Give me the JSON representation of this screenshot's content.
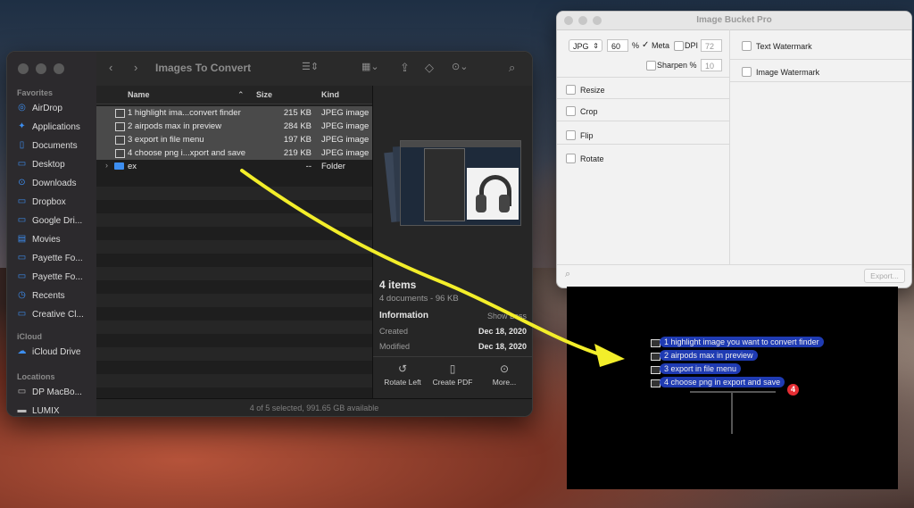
{
  "finder": {
    "title": "Images To Convert",
    "sidebar": {
      "favorites_header": "Favorites",
      "favorites": [
        {
          "label": "AirDrop",
          "icon": "airdrop-icon"
        },
        {
          "label": "Applications",
          "icon": "applications-icon"
        },
        {
          "label": "Documents",
          "icon": "document-icon"
        },
        {
          "label": "Desktop",
          "icon": "desktop-icon"
        },
        {
          "label": "Downloads",
          "icon": "downloads-icon"
        },
        {
          "label": "Dropbox",
          "icon": "folder-icon"
        },
        {
          "label": "Google Dri...",
          "icon": "folder-icon"
        },
        {
          "label": "Movies",
          "icon": "movies-icon"
        },
        {
          "label": "Payette Fo...",
          "icon": "folder-icon"
        },
        {
          "label": "Payette Fo...",
          "icon": "folder-icon"
        },
        {
          "label": "Recents",
          "icon": "clock-icon"
        },
        {
          "label": "Creative Cl...",
          "icon": "folder-icon"
        }
      ],
      "icloud_header": "iCloud",
      "icloud": [
        {
          "label": "iCloud Drive",
          "icon": "cloud-icon"
        }
      ],
      "locations_header": "Locations",
      "locations": [
        {
          "label": "DP MacBo...",
          "icon": "laptop-icon"
        },
        {
          "label": "LUMIX",
          "icon": "disk-icon"
        }
      ]
    },
    "columns": {
      "name": "Name",
      "size": "Size",
      "kind": "Kind"
    },
    "rows": [
      {
        "name": "1 highlight ima...convert finder",
        "size": "215 KB",
        "kind": "JPEG image",
        "selected": true
      },
      {
        "name": "2 airpods max in preview",
        "size": "284 KB",
        "kind": "JPEG image",
        "selected": true
      },
      {
        "name": "3 export in file menu",
        "size": "197 KB",
        "kind": "JPEG image",
        "selected": true
      },
      {
        "name": "4 choose png i...xport and save",
        "size": "219 KB",
        "kind": "JPEG image",
        "selected": true
      },
      {
        "name": "ex",
        "size": "--",
        "kind": "Folder",
        "selected": false
      }
    ],
    "preview": {
      "count": "4 items",
      "subtitle": "4 documents - 9",
      "subtitle_tail": "6 KB",
      "info_header": "Information",
      "show_less": "Show Less",
      "created_label": "Created",
      "created_value": "Dec 18, 2020",
      "modified_label": "Modified",
      "modified_value": "Dec 18, 2020",
      "actions": [
        {
          "label": "Rotate Left",
          "icon": "rotate-left-icon"
        },
        {
          "label": "Create PDF",
          "icon": "pdf-icon"
        },
        {
          "label": "More...",
          "icon": "more-icon"
        }
      ]
    },
    "status": "4 of 5 selected, 991.65 GB available"
  },
  "bucket": {
    "title": "Image Bucket Pro",
    "format": "JPG",
    "quality": "60",
    "quality_unit": "%",
    "meta_label": "Meta",
    "meta_checked": true,
    "dpi_label": "DPI",
    "dpi_value": "72",
    "sharpen_label": "Sharpen %",
    "sharpen_value": "10",
    "options": [
      "Resize",
      "Crop",
      "Flip",
      "Rotate"
    ],
    "right_options": [
      "Text Watermark",
      "Image Watermark"
    ],
    "export_label": "Export..."
  },
  "drop": {
    "items": [
      "1 highlight image you want to convert finder",
      "2 airpods max in preview",
      "3 export in file menu",
      "4 choose png in export and save"
    ],
    "badge": "4"
  },
  "colors": {
    "arrow": "#f3ee2a",
    "pill": "#1f3bb3",
    "badge": "#e52d33",
    "sidebar_icon": "#3d8ef0"
  }
}
